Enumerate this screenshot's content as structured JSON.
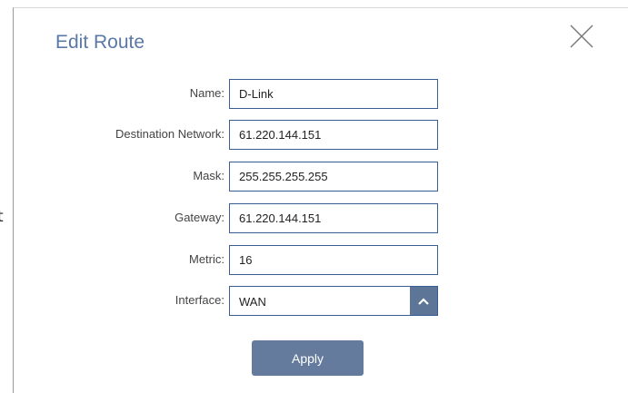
{
  "background_text": "t",
  "dialog": {
    "title": "Edit Route",
    "fields": [
      {
        "label": "Name:",
        "value": "D-Link"
      },
      {
        "label": "Destination Network:",
        "value": "61.220.144.151"
      },
      {
        "label": "Mask:",
        "value": "255.255.255.255"
      },
      {
        "label": "Gateway:",
        "value": "61.220.144.151"
      },
      {
        "label": "Metric:",
        "value": "16"
      }
    ],
    "interface": {
      "label": "Interface:",
      "value": "WAN"
    },
    "apply_label": "Apply"
  },
  "icons": {
    "close": "close-icon",
    "dropdown": "chevron-up-icon"
  },
  "colors": {
    "accent": "#5a78a8",
    "field_border": "#3a5d94",
    "button": "#647b9e"
  }
}
